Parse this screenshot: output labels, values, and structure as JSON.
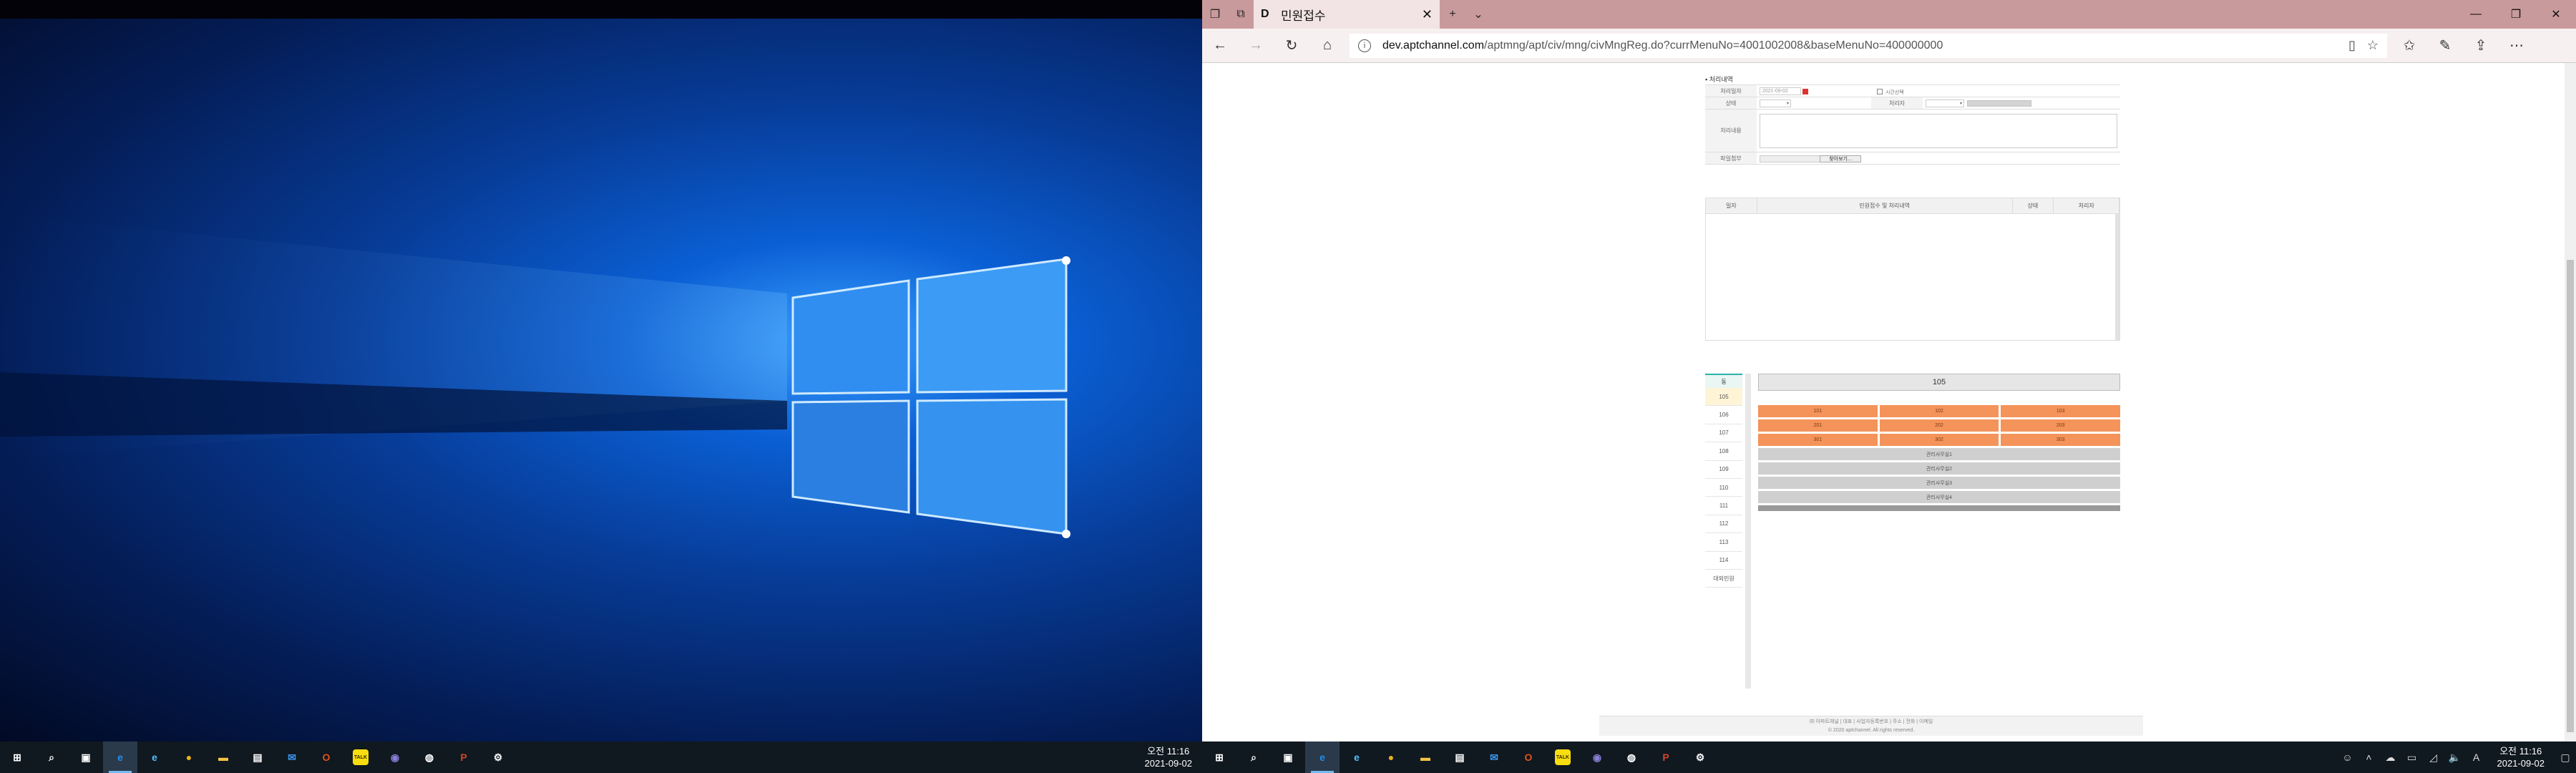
{
  "left_taskbar": {
    "icons": [
      {
        "name": "start-icon",
        "glyph": "⊞",
        "color": "#ffffff"
      },
      {
        "name": "search-icon",
        "glyph": "⌕",
        "color": "#ffffff"
      },
      {
        "name": "task-view-icon",
        "glyph": "▣",
        "color": "#ffffff"
      },
      {
        "name": "edge-icon",
        "glyph": "e",
        "color": "#1f8ef1",
        "active": true
      },
      {
        "name": "ie-icon",
        "glyph": "e",
        "color": "#56c1ff"
      },
      {
        "name": "chrome-icon",
        "glyph": "●",
        "color": "#e8b21e"
      },
      {
        "name": "file-explorer-icon",
        "glyph": "▬",
        "color": "#f3c442"
      },
      {
        "name": "store-icon",
        "glyph": "▤",
        "color": "#ffffff"
      },
      {
        "name": "mail-icon",
        "glyph": "✉",
        "color": "#3b95e8"
      },
      {
        "name": "office-icon",
        "glyph": "O",
        "color": "#e2521c"
      },
      {
        "name": "kakaotalk-icon",
        "glyph": "TALK",
        "color": "#f8de10"
      },
      {
        "name": "app-icon",
        "glyph": "◉",
        "color": "#8a7fd6"
      },
      {
        "name": "signal-icon",
        "glyph": "◍",
        "color": "#ffffff"
      },
      {
        "name": "powerpoint-icon",
        "glyph": "P",
        "color": "#d24625"
      },
      {
        "name": "settings-icon",
        "glyph": "⚙",
        "color": "#ffffff"
      }
    ],
    "clock_time": "오전 11:16",
    "clock_date": "2021-09-02"
  },
  "right_taskbar": {
    "icons": [
      {
        "name": "start-icon",
        "glyph": "⊞",
        "color": "#ffffff"
      },
      {
        "name": "search-icon",
        "glyph": "⌕",
        "color": "#ffffff"
      },
      {
        "name": "task-view-icon",
        "glyph": "▣",
        "color": "#ffffff"
      },
      {
        "name": "edge-icon",
        "glyph": "e",
        "color": "#1f8ef1",
        "active": true
      },
      {
        "name": "ie-icon",
        "glyph": "e",
        "color": "#56c1ff"
      },
      {
        "name": "chrome-icon",
        "glyph": "●",
        "color": "#e8b21e"
      },
      {
        "name": "file-explorer-icon",
        "glyph": "▬",
        "color": "#f3c442"
      },
      {
        "name": "store-icon",
        "glyph": "▤",
        "color": "#ffffff"
      },
      {
        "name": "mail-icon",
        "glyph": "✉",
        "color": "#3b95e8"
      },
      {
        "name": "office-icon",
        "glyph": "O",
        "color": "#e2521c"
      },
      {
        "name": "kakaotalk-icon",
        "glyph": "TALK",
        "color": "#f8de10"
      },
      {
        "name": "app-icon",
        "glyph": "◉",
        "color": "#8a7fd6"
      },
      {
        "name": "signal-icon",
        "glyph": "◍",
        "color": "#ffffff"
      },
      {
        "name": "powerpoint-icon",
        "glyph": "P",
        "color": "#d24625"
      },
      {
        "name": "settings-icon",
        "glyph": "⚙",
        "color": "#ffffff"
      }
    ],
    "clock_time": "오전 11:16",
    "clock_date": "2021-09-02"
  },
  "browser": {
    "tab_title": "민원접수",
    "tab_favicon": "D",
    "url_domain": "dev.aptchannel.com",
    "url_path": "/aptmng/apt/civ/mng/civMngReg.do?currMenuNo=4001002008&baseMenuNo=400000000",
    "accent": "#c99a9c"
  },
  "form": {
    "section_title": "▪ 처리내역",
    "date_label": "처리일자",
    "date_value": "2021-09-02",
    "checkbox_label": "시간선택",
    "status_label": "상태",
    "handler_label": "처리자",
    "detail_label": "처리내용",
    "file_label": "파일첨부",
    "file_button": "찾아보기..."
  },
  "history_table": {
    "columns": [
      "일자",
      "민원접수 및 처리내역",
      "상태",
      "처리자"
    ]
  },
  "dong_list": {
    "header": "동",
    "items": [
      "105",
      "106",
      "107",
      "108",
      "109",
      "110",
      "111",
      "112",
      "113",
      "114",
      "대외민원"
    ],
    "selected": "105"
  },
  "units": {
    "title": "105",
    "cells": [
      "101",
      "102",
      "103",
      "201",
      "202",
      "203",
      "301",
      "302",
      "303"
    ],
    "control_rows": [
      "관리사무실1",
      "관리사무실2",
      "관리사무실3",
      "관리사무실4"
    ],
    "cell_color": "#f4935a"
  },
  "footer": {
    "line1": "㈜ 아파트채널 | 대표 | 사업자등록번호 | 주소 | 전화 | 이메일",
    "line2": "© 2020 aptchannel. All rights reserved."
  }
}
